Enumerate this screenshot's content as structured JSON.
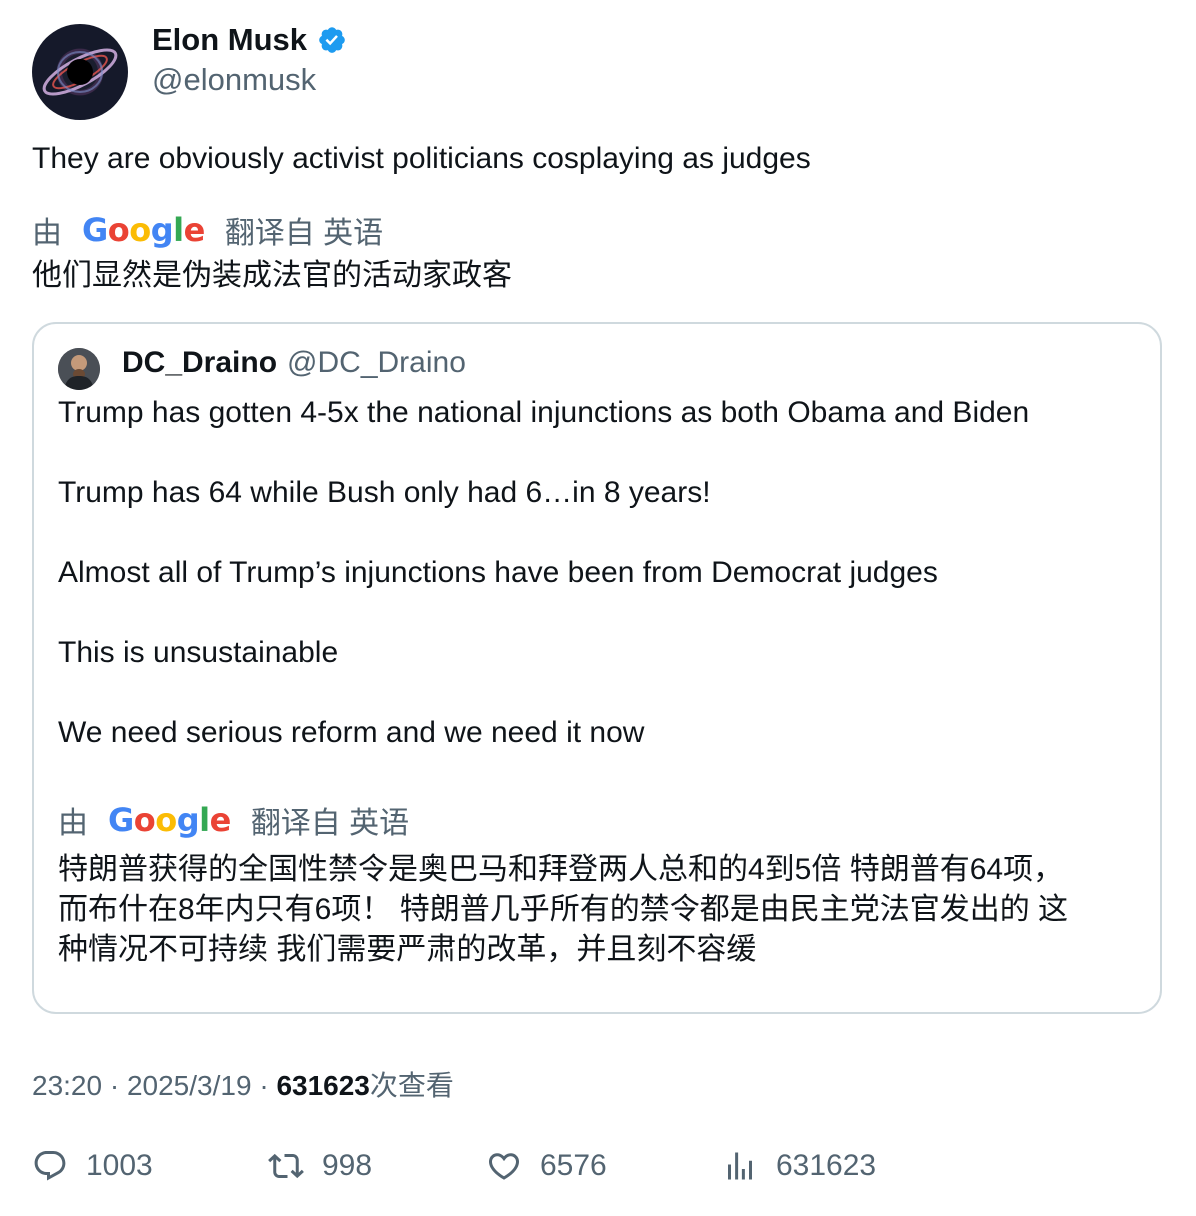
{
  "author": {
    "name": "Elon Musk",
    "handle": "@elonmusk",
    "verified": true
  },
  "tweet": {
    "text": "They are obviously activist politicians cosplaying as judges",
    "translation": {
      "prefix": "由",
      "provider": "Google",
      "suffix": "翻译自 英语",
      "text": "他们显然是伪装成法官的活动家政客"
    }
  },
  "quoted_tweet": {
    "name": "DC_Draino",
    "handle": "@DC_Draino",
    "lines": [
      "Trump has gotten 4-5x the national injunctions as both Obama and Biden",
      "Trump has 64 while Bush only had 6…in 8 years!",
      "Almost all of Trump’s injunctions have been from Democrat judges",
      "This is unsustainable",
      "We need serious reform and we need it now"
    ],
    "translation": {
      "prefix": "由",
      "provider": "Google",
      "suffix": "翻译自 英语",
      "lines": [
        "特朗普获得的全国性禁令是奥巴马和拜登两人总和的4到5倍 特朗普有64项，",
        "而布什在8年内只有6项！ 特朗普几乎所有的禁令都是由民主党法官发出的 这",
        "种情况不可持续 我们需要严肃的改革，并且刻不容缓"
      ]
    }
  },
  "meta": {
    "time": "23:20",
    "sep1": " · ",
    "date": "2025/3/19",
    "sep2": " · ",
    "views": "631623",
    "views_label": "次查看"
  },
  "actions": {
    "replies": "1003",
    "reposts": "998",
    "likes": "6576",
    "views": "631623"
  },
  "colors": {
    "verified": "#1d9bf0",
    "secondary_text": "#536471",
    "primary_text": "#0f1419",
    "border": "#cfd9de"
  }
}
